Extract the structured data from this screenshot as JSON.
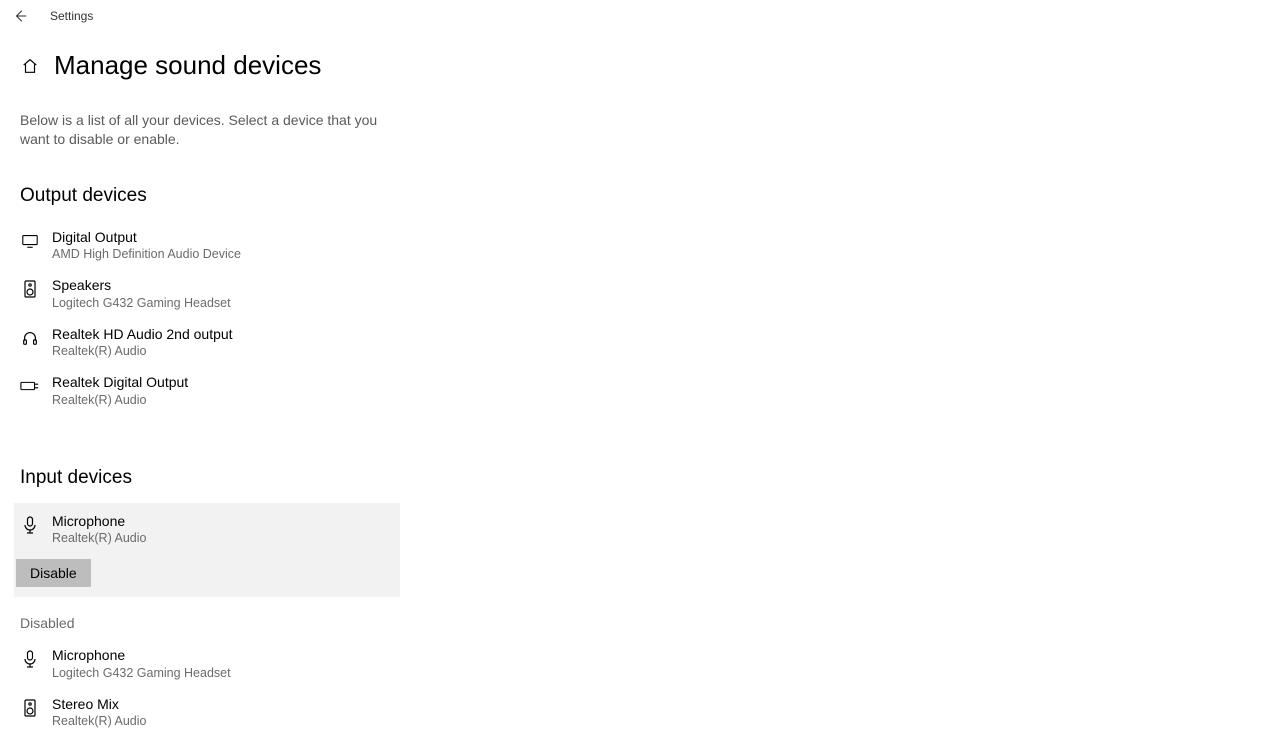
{
  "app_name": "Settings",
  "page_title": "Manage sound devices",
  "intro": "Below is a list of all your devices. Select a device that you want to disable or enable.",
  "sections": {
    "output": {
      "title": "Output devices",
      "items": [
        {
          "name": "Digital Output",
          "sub": "AMD High Definition Audio Device",
          "icon": "monitor"
        },
        {
          "name": "Speakers",
          "sub": "Logitech G432 Gaming Headset",
          "icon": "speaker"
        },
        {
          "name": "Realtek HD Audio 2nd output",
          "sub": "Realtek(R) Audio",
          "icon": "headphones"
        },
        {
          "name": "Realtek Digital Output",
          "sub": "Realtek(R) Audio",
          "icon": "digital"
        }
      ]
    },
    "input": {
      "title": "Input devices",
      "selected": {
        "name": "Microphone",
        "sub": "Realtek(R) Audio",
        "icon": "mic",
        "action_label": "Disable"
      },
      "disabled_label": "Disabled",
      "disabled_items": [
        {
          "name": "Microphone",
          "sub": "Logitech G432 Gaming Headset",
          "icon": "mic"
        },
        {
          "name": "Stereo Mix",
          "sub": "Realtek(R) Audio",
          "icon": "speaker"
        }
      ]
    }
  }
}
